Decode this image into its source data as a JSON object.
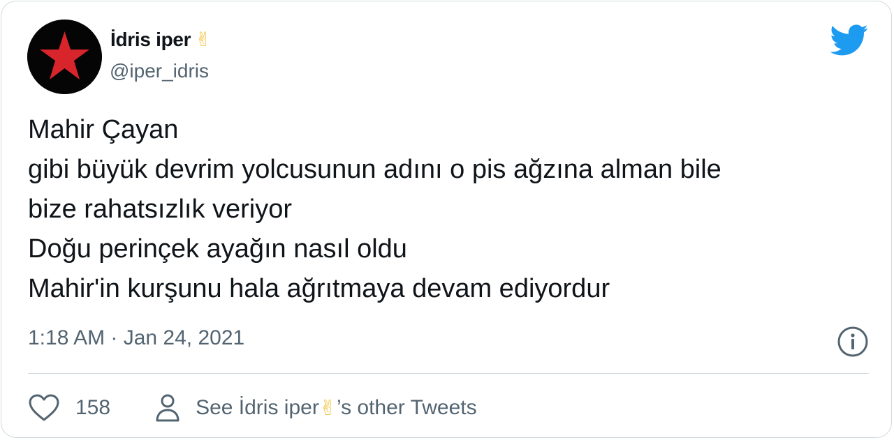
{
  "author": {
    "display_name": "İdris iper",
    "name_emoji": "✌",
    "handle": "@iper_idris",
    "avatar_icon": "red-star-icon"
  },
  "brand": {
    "icon": "twitter-bird-icon",
    "color": "#1d9bf0"
  },
  "tweet": {
    "lines": [
      "Mahir Çayan",
      "gibi büyük devrim yolcusunun adını o pis ağzına alman bile",
      "bize rahatsızlık veriyor",
      "Doğu perinçek ayağın nasıl oldu",
      "Mahir'in kurşunu hala ağrıtmaya devam ediyordur"
    ],
    "timestamp": "1:18 AM · Jan 24, 2021"
  },
  "actions": {
    "like_count": "158",
    "other_tweets_prefix": "See İdris iper",
    "other_tweets_emoji": "✌",
    "other_tweets_suffix": "’s other Tweets"
  },
  "colors": {
    "text": "#0f1419",
    "muted": "#536471",
    "border": "#cfd9de",
    "star": "#d8242b"
  }
}
